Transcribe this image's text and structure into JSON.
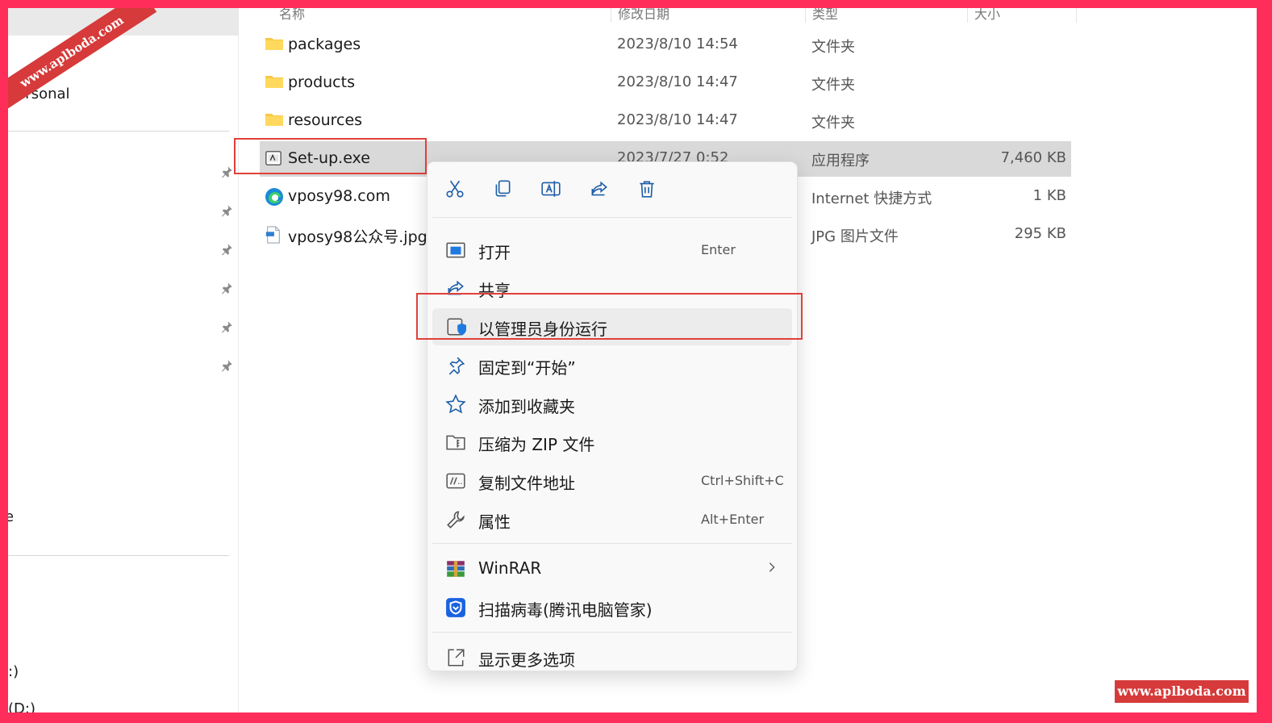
{
  "sidebar": {
    "items": [
      {
        "label": "Personal"
      },
      {
        "label": "e"
      },
      {
        "label": ":)"
      },
      {
        "label": "(D:)"
      }
    ]
  },
  "columns": [
    {
      "label": "名称"
    },
    {
      "label": "修改日期"
    },
    {
      "label": "类型"
    },
    {
      "label": "大小"
    }
  ],
  "files": [
    {
      "name": "packages",
      "date": "2023/8/10 14:54",
      "type": "文件夹",
      "size": "",
      "icon": "folder-icon"
    },
    {
      "name": "products",
      "date": "2023/8/10 14:47",
      "type": "文件夹",
      "size": "",
      "icon": "folder-icon"
    },
    {
      "name": "resources",
      "date": "2023/8/10 14:47",
      "type": "文件夹",
      "size": "",
      "icon": "folder-icon"
    },
    {
      "name": "Set-up.exe",
      "date": "2023/7/27 0:52",
      "type": "应用程序",
      "size": "7,460 KB",
      "icon": "exe-icon"
    },
    {
      "name": "vposy98.com",
      "date": "",
      "type": "Internet 快捷方式",
      "size": "1 KB",
      "icon": "edge-icon"
    },
    {
      "name": "vposy98公众号.jpg",
      "date": "",
      "type": "JPG 图片文件",
      "size": "295 KB",
      "icon": "jpg-icon"
    }
  ],
  "context_menu": {
    "toolbar": [
      {
        "icon": "cut-icon"
      },
      {
        "icon": "copy-icon"
      },
      {
        "icon": "rename-icon"
      },
      {
        "icon": "share-icon"
      },
      {
        "icon": "delete-icon"
      }
    ],
    "items": [
      {
        "label": "打开",
        "shortcut": "Enter",
        "icon": "open-icon"
      },
      {
        "label": "共享",
        "shortcut": "",
        "icon": "share-icon"
      },
      {
        "label": "以管理员身份运行",
        "shortcut": "",
        "icon": "shield-icon"
      },
      {
        "label": "固定到“开始”",
        "shortcut": "",
        "icon": "pin-icon"
      },
      {
        "label": "添加到收藏夹",
        "shortcut": "",
        "icon": "star-icon"
      },
      {
        "label": "压缩为 ZIP 文件",
        "shortcut": "",
        "icon": "zip-icon"
      },
      {
        "label": "复制文件地址",
        "shortcut": "Ctrl+Shift+C",
        "icon": "path-icon"
      },
      {
        "label": "属性",
        "shortcut": "Alt+Enter",
        "icon": "wrench-icon"
      },
      {
        "label": "WinRAR",
        "shortcut": "",
        "icon": "winrar-icon"
      },
      {
        "label": "扫描病毒(腾讯电脑管家)",
        "shortcut": "",
        "icon": "tencent-shield-icon"
      },
      {
        "label": "显示更多选项",
        "shortcut": "",
        "icon": "more-options-icon"
      }
    ]
  },
  "watermarks": {
    "corner": "www.aplboda.com",
    "badge": "www.aplboda.com"
  },
  "colors": {
    "border": "#ff2d5a",
    "highlight": "#e0403a",
    "accent": "#1f5fa8",
    "watermark": "#d63a3a"
  }
}
